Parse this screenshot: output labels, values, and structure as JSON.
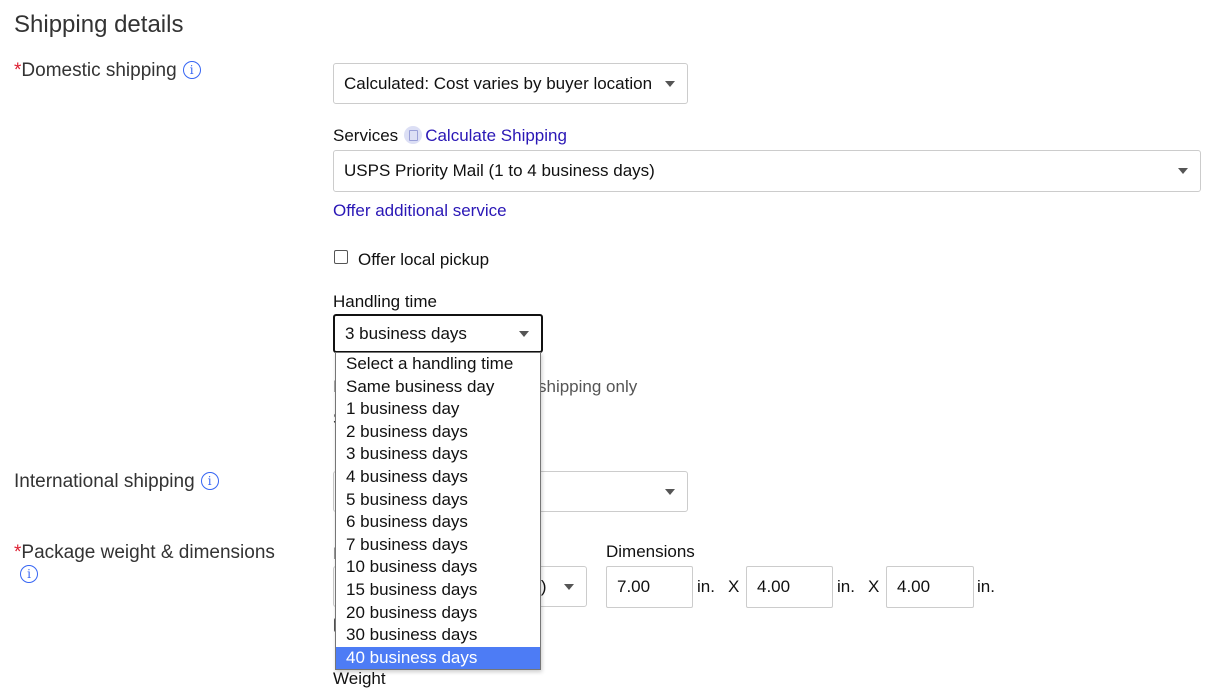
{
  "page": {
    "title": "Shipping details"
  },
  "domestic": {
    "required_mark": "*",
    "label": "Domestic shipping",
    "method_value": "Calculated: Cost varies by buyer location",
    "services_label": "Services",
    "calculate_link": "Calculate Shipping",
    "service_value": "USPS Priority Mail (1 to 4 business days)",
    "offer_additional": "Offer additional service",
    "local_pickup_label": "Offer local pickup",
    "handling_label": "Handling time",
    "handling_value": "3 business days",
    "behind_text": "shipping only",
    "behind_letter_a": "I",
    "behind_letter_b": "S"
  },
  "handling_options": [
    "Select a handling time",
    "Same business day",
    "1 business day",
    "2 business days",
    "3 business days",
    "4 business days",
    "5 business days",
    "6 business days",
    "7 business days",
    "10 business days",
    "15 business days",
    "20 business days",
    "30 business days",
    "40 business days"
  ],
  "highlighted_option": "40 business days",
  "international": {
    "label": "International shipping"
  },
  "package": {
    "required_mark": "*",
    "label": "Package weight & dimensions",
    "type_partial": "pe)",
    "dimensions_label": "Dimensions",
    "length": "7.00",
    "width": "4.00",
    "height": "4.00",
    "unit": "in.",
    "times": "X",
    "weight_label": "Weight",
    "partial_letter": "I"
  },
  "colors": {
    "accent": "#3665f3",
    "link": "#2a17b6",
    "required": "#dd1e31",
    "highlight": "#4d7cf5"
  }
}
